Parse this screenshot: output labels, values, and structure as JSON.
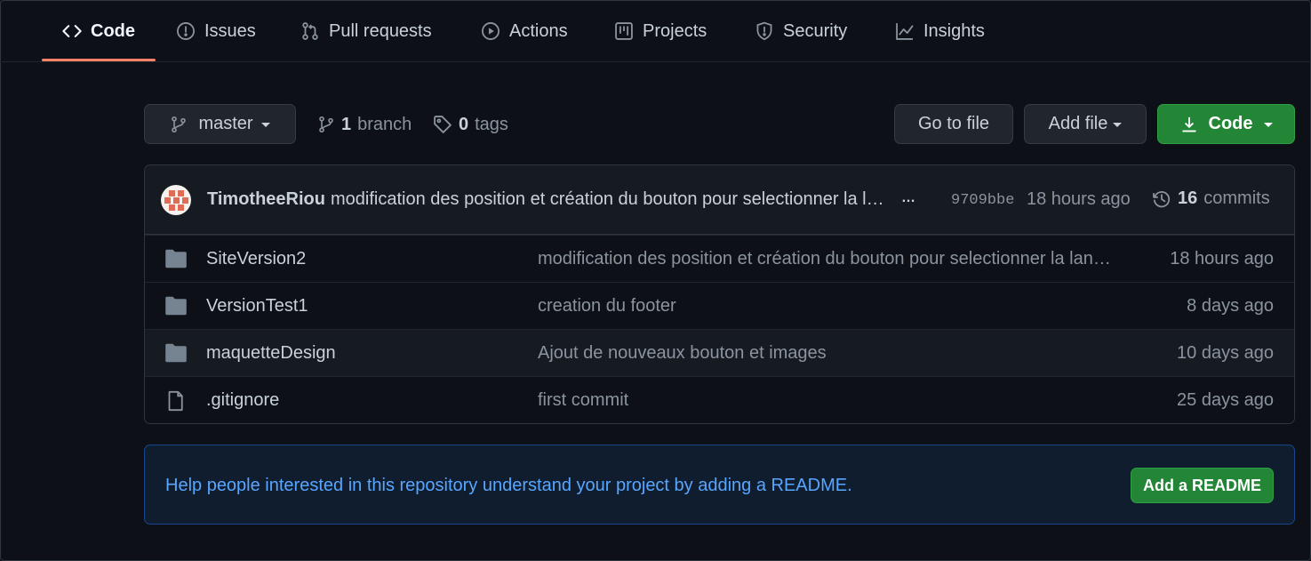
{
  "nav": {
    "tabs": [
      {
        "label": "Code",
        "icon": "code-icon",
        "active": true
      },
      {
        "label": "Issues",
        "icon": "issue-icon"
      },
      {
        "label": "Pull requests",
        "icon": "pull-request-icon"
      },
      {
        "label": "Actions",
        "icon": "play-icon"
      },
      {
        "label": "Projects",
        "icon": "project-board-icon"
      },
      {
        "label": "Security",
        "icon": "shield-icon"
      },
      {
        "label": "Insights",
        "icon": "graph-icon"
      }
    ],
    "active_color": "#f78166"
  },
  "toolbar": {
    "branch": "master",
    "branch_count": "1",
    "branch_label": "branch",
    "tag_count": "0",
    "tag_label": "tags",
    "go_to_file": "Go to file",
    "add_file": "Add file",
    "code_button": "Code"
  },
  "latest_commit": {
    "author": "TimotheeRiou",
    "message": "modification des position et création du bouton pour selectionner la langue",
    "more": "…",
    "sha": "9709bbe",
    "time": "18 hours ago",
    "commit_count": "16",
    "commit_label": "commits"
  },
  "files": [
    {
      "name": "SiteVersion2",
      "type": "folder",
      "message": "modification des position et création du bouton pour selectionner la langue",
      "age": "18 hours ago"
    },
    {
      "name": "VersionTest1",
      "type": "folder",
      "message": "creation du footer",
      "age": "8 days ago"
    },
    {
      "name": "maquetteDesign",
      "type": "folder",
      "message": "Ajout de nouveaux bouton et images",
      "age": "10 days ago"
    },
    {
      "name": ".gitignore",
      "type": "file",
      "message": "first commit",
      "age": "25 days ago"
    }
  ],
  "readme_banner": {
    "text": "Help people interested in this repository understand your project by adding a README.",
    "button": "Add a README"
  },
  "colors": {
    "background": "#0d1117",
    "accent_green": "#238636",
    "link_blue": "#58a6ff",
    "folder": "#768390"
  }
}
